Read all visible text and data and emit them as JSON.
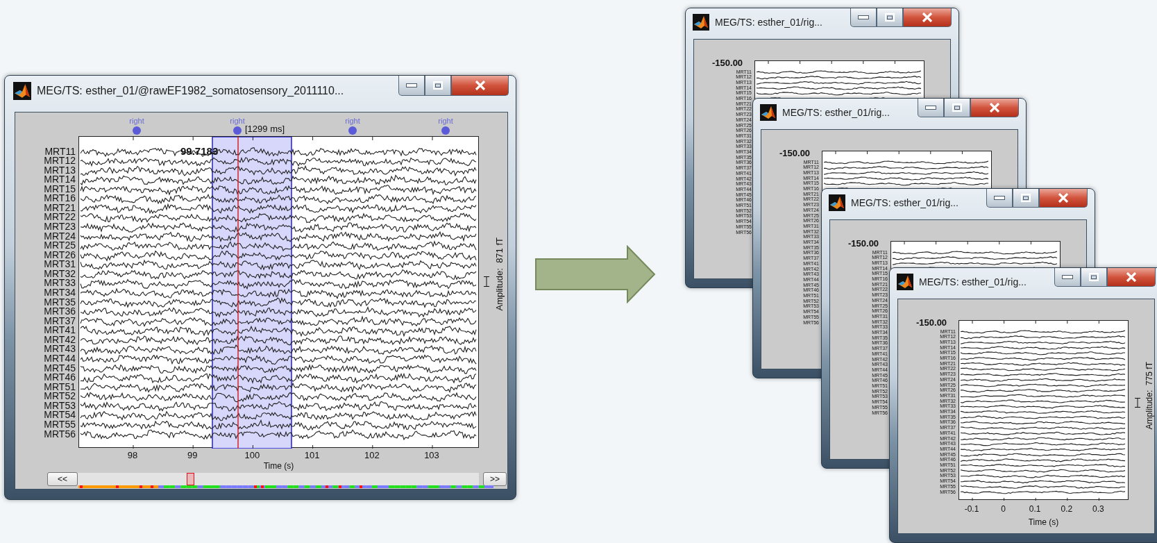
{
  "main_window": {
    "title": "MEG/TS: esther_01/@rawEF1982_somatosensory_2011110...",
    "events": [
      {
        "label": "right"
      },
      {
        "label": "right"
      },
      {
        "label": "right"
      },
      {
        "label": "right"
      }
    ],
    "time_cursor": "[1299 ms]",
    "cursor_value": "99.7183",
    "channels": [
      "MRT11",
      "MRT12",
      "MRT13",
      "MRT14",
      "MRT15",
      "MRT16",
      "MRT21",
      "MRT22",
      "MRT23",
      "MRT24",
      "MRT25",
      "MRT26",
      "MRT31",
      "MRT32",
      "MRT33",
      "MRT34",
      "MRT35",
      "MRT36",
      "MRT37",
      "MRT41",
      "MRT42",
      "MRT43",
      "MRT44",
      "MRT45",
      "MRT46",
      "MRT51",
      "MRT52",
      "MRT53",
      "MRT54",
      "MRT55",
      "MRT56"
    ],
    "x_ticks": [
      "98",
      "99",
      "100",
      "101",
      "102",
      "103"
    ],
    "xlabel": "Time (s)",
    "amplitude": "Amplitude:  871 fT",
    "scroll": {
      "back": "<<",
      "forward": ">>"
    }
  },
  "stacked_windows": [
    {
      "title": "MEG/TS: esther_01/rig...",
      "offset_label": "-150.00",
      "channels": [
        "MRT11",
        "MRT12",
        "MRT13",
        "MRT14",
        "MRT15",
        "MRT16",
        "MRT21",
        "MRT22",
        "MRT23",
        "MRT24",
        "MRT25",
        "MRT26",
        "MRT31",
        "MRT32",
        "MRT33",
        "MRT34",
        "MRT35",
        "MRT36",
        "MRT37",
        "MRT41",
        "MRT42",
        "MRT43",
        "MRT44",
        "MRT45",
        "MRT46",
        "MRT51",
        "MRT52",
        "MRT53",
        "MRT54",
        "MRT55",
        "MRT56"
      ]
    },
    {
      "title": "MEG/TS: esther_01/rig...",
      "offset_label": "-150.00",
      "channels": [
        "MRT11",
        "MRT12",
        "MRT13",
        "MRT14",
        "MRT15",
        "MRT16",
        "MRT21",
        "MRT22",
        "MRT23",
        "MRT24",
        "MRT25",
        "MRT26",
        "MRT31",
        "MRT32",
        "MRT33",
        "MRT34",
        "MRT35",
        "MRT36",
        "MRT37",
        "MRT41",
        "MRT42",
        "MRT43",
        "MRT44",
        "MRT45",
        "MRT46",
        "MRT51",
        "MRT52",
        "MRT53",
        "MRT54",
        "MRT55",
        "MRT56"
      ]
    },
    {
      "title": "MEG/TS: esther_01/rig...",
      "offset_label": "-150.00",
      "channels": [
        "MRT11",
        "MRT12",
        "MRT13",
        "MRT14",
        "MRT15",
        "MRT16",
        "MRT21",
        "MRT22",
        "MRT23",
        "MRT24",
        "MRT25",
        "MRT26",
        "MRT31",
        "MRT32",
        "MRT33",
        "MRT34",
        "MRT35",
        "MRT36",
        "MRT37",
        "MRT41",
        "MRT42",
        "MRT43",
        "MRT44",
        "MRT45",
        "MRT46",
        "MRT51",
        "MRT52",
        "MRT53",
        "MRT54",
        "MRT55",
        "MRT56"
      ]
    },
    {
      "title": "MEG/TS: esther_01/rig...",
      "offset_label": "-150.00",
      "channels": [
        "MRT11",
        "MRT12",
        "MRT13",
        "MRT14",
        "MRT15",
        "MRT16",
        "MRT21",
        "MRT22",
        "MRT23",
        "MRT24",
        "MRT25",
        "MRT26",
        "MRT31",
        "MRT32",
        "MRT33",
        "MRT34",
        "MRT35",
        "MRT36",
        "MRT37",
        "MRT41",
        "MRT42",
        "MRT43",
        "MRT44",
        "MRT45",
        "MRT46",
        "MRT51",
        "MRT52",
        "MRT53",
        "MRT54",
        "MRT55",
        "MRT56"
      ],
      "x_ticks": [
        "-0.1",
        "0",
        "0.1",
        "0.2",
        "0.3"
      ],
      "xlabel": "Time (s)",
      "amplitude": "Amplitude:  775 fT"
    }
  ]
}
